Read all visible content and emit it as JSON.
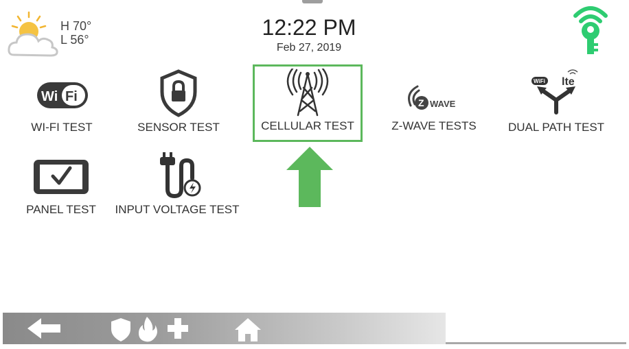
{
  "weather": {
    "high": "H 70°",
    "low": "L 56°",
    "icon": "partly-cloudy-icon"
  },
  "clock": {
    "time": "12:22 PM",
    "date": "Feb 27, 2019"
  },
  "status": {
    "icon": "key-signal-icon",
    "color": "#2ecc71"
  },
  "tiles": [
    {
      "label": "WI-FI TEST",
      "icon": "wifi-icon"
    },
    {
      "label": "SENSOR TEST",
      "icon": "shield-lock-icon"
    },
    {
      "label": "CELLULAR TEST",
      "icon": "cell-tower-icon",
      "highlighted": true
    },
    {
      "label": "Z-WAVE TESTS",
      "icon": "zwave-icon"
    },
    {
      "label": "DUAL PATH TEST",
      "icon": "dual-path-icon"
    },
    {
      "label": "PANEL TEST",
      "icon": "panel-check-icon"
    },
    {
      "label": "INPUT VOLTAGE TEST",
      "icon": "power-plug-icon"
    }
  ],
  "bottom_bar": {
    "buttons": [
      "back-arrow-icon",
      "shield-icon",
      "fire-icon",
      "medical-plus-icon",
      "home-icon"
    ]
  },
  "colors": {
    "highlight": "#5cb85c",
    "accent_green": "#2ecc71",
    "icon_dark": "#333333"
  }
}
